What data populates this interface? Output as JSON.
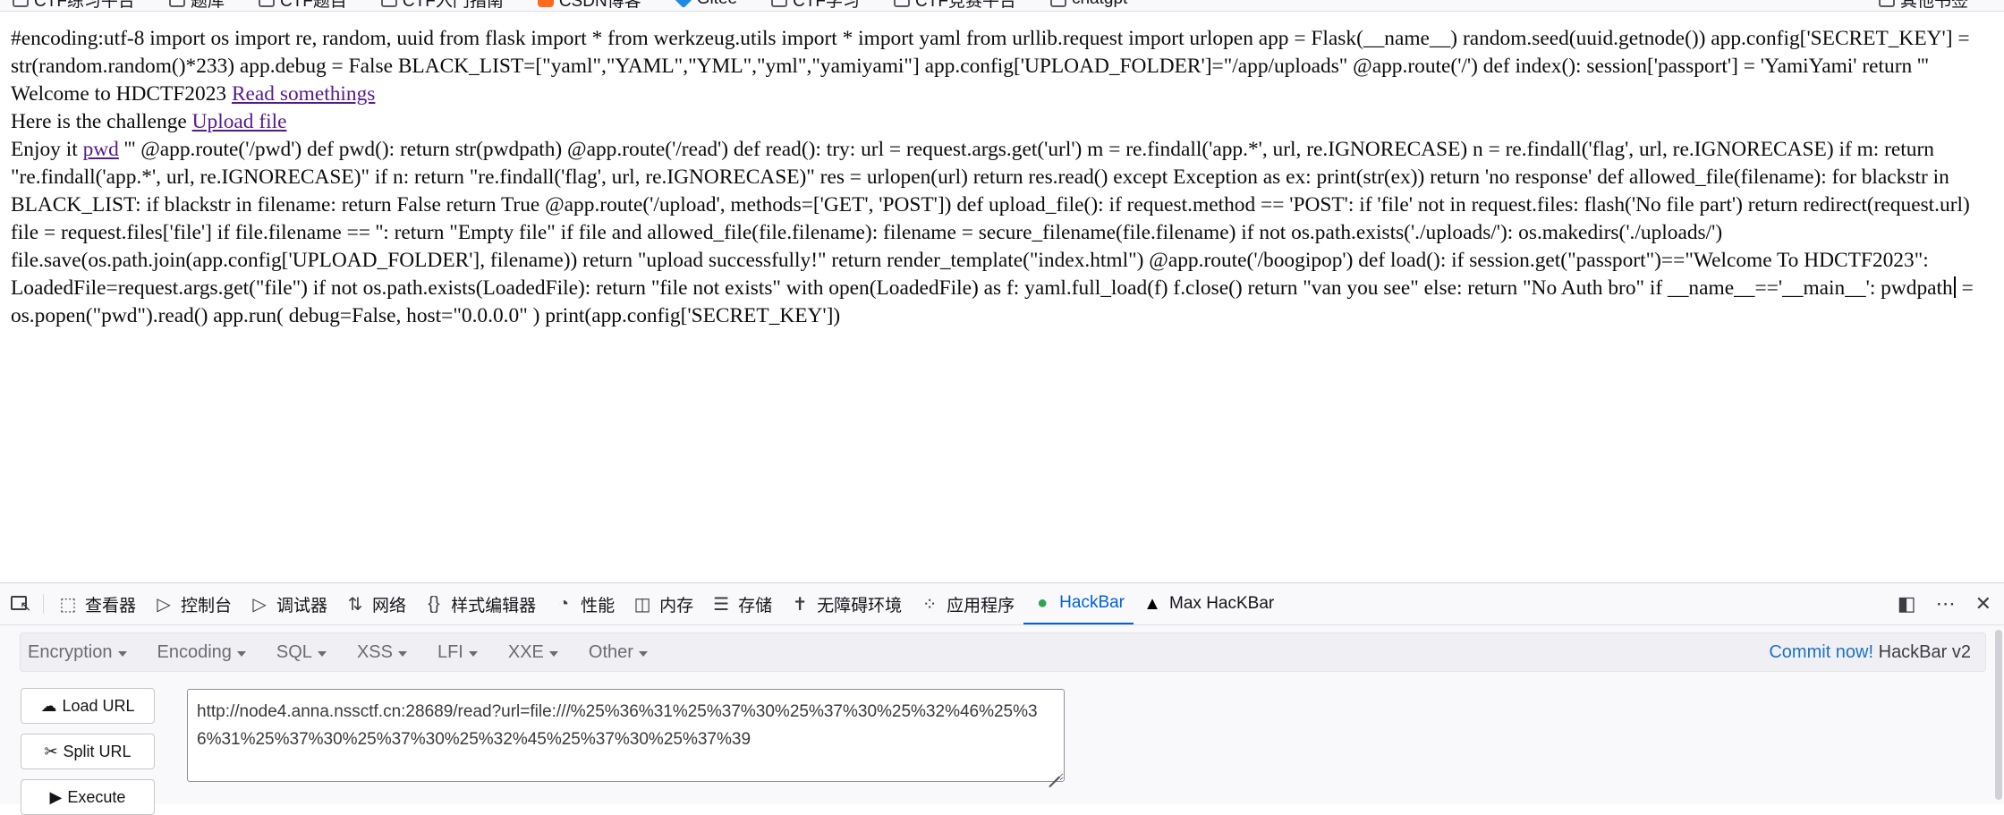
{
  "bookmarks": {
    "items": [
      "CTF练习平台",
      "题库",
      "CTF题目",
      "CTF入门指南",
      "CSDN博客",
      "Gitee",
      "CTF学习",
      "CTF竞赛平台",
      "chatgpt"
    ],
    "right_label": "其他书签"
  },
  "page": {
    "line1": "#encoding:utf-8 import os import re, random, uuid from flask import * from werkzeug.utils import * import yaml from urllib.request import urlopen app = Flask(__name__) random.seed(uuid.getnode()) app.config['SECRET_KEY'] = str(random.random()*233) app.debug = False BLACK_LIST=[\"yaml\",\"YAML\",\"YML\",\"yml\",\"yamiyami\"] app.config['UPLOAD_FOLDER']=\"/app/uploads\" @app.route('/') def index(): session['passport'] = 'YamiYami' return ''' Welcome to HDCTF2023 ",
    "link_read": "Read somethings",
    "challenge_prefix": "Here is the challenge ",
    "link_upload": "Upload file",
    "enjoy_prefix": "Enjoy it ",
    "link_pwd": "pwd",
    "code_rest_a": " ''' @app.route('/pwd') def pwd(): return str(pwdpath) @app.route('/read') def read(): try: url = request.args.get('url') m = re.findall('app.*', url, re.IGNORECASE) n = re.findall('flag', url, re.IGNORECASE) if m: return \"re.findall('app.*', url, re.IGNORECASE)\" if n: return \"re.findall('flag', url, re.IGNORECASE)\" res = urlopen(url) return res.read() except Exception as ex: print(str(ex)) return 'no response' def allowed_file(filename): for blackstr in BLACK_LIST: if blackstr in filename: return False return True @app.route('/upload', methods=['GET', 'POST']) def upload_file(): if request.method == 'POST': if 'file' not in request.files: flash('No file part') return redirect(request.url) file = request.files['file'] if file.filename == '': return \"Empty file\" if file and allowed_file(file.filename): filename = secure_filename(file.filename) if not os.path.exists('./uploads/'): os.makedirs('./uploads/') file.save(os.path.join(app.config['UPLOAD_FOLDER'], filename)) return \"upload successfully!\" return render_template(\"index.html\") @app.route('/boogipop') def load(): if session.get(\"passport\")==\"Welcome To HDCTF2023\": LoadedFile=request.args.get(\"file\") if not os.path.exists(LoadedFile): return \"file not exists\" with open(LoadedFile) as f: yaml.full_load(f) f.close() return \"van you see\" else: return \"No Auth bro\" if __name__=='__main__': pwdpath",
    "code_rest_b": " = os.popen(\"pwd\").read() app.run( debug=False, host=\"0.0.0.0\" ) print(app.config['SECRET_KEY'])"
  },
  "devtools": {
    "tabs": [
      {
        "label": "查看器",
        "icon": "inspector-icon"
      },
      {
        "label": "控制台",
        "icon": "console-icon"
      },
      {
        "label": "调试器",
        "icon": "debugger-icon"
      },
      {
        "label": "网络",
        "icon": "network-icon"
      },
      {
        "label": "样式编辑器",
        "icon": "style-editor-icon"
      },
      {
        "label": "性能",
        "icon": "performance-icon"
      },
      {
        "label": "内存",
        "icon": "memory-icon"
      },
      {
        "label": "存储",
        "icon": "storage-icon"
      },
      {
        "label": "无障碍环境",
        "icon": "accessibility-icon"
      },
      {
        "label": "应用程序",
        "icon": "application-icon"
      },
      {
        "label": "HackBar",
        "icon": "hackbar-icon"
      },
      {
        "label": "Max HacKBar",
        "icon": "max-hackbar-icon"
      }
    ],
    "active_tab": "HackBar",
    "accent_color": "#0060df"
  },
  "hackbar": {
    "menus": [
      "Encryption",
      "Encoding",
      "SQL",
      "XSS",
      "LFI",
      "XXE",
      "Other"
    ],
    "commit_link": "Commit now!",
    "version": " HackBar v2",
    "buttons": {
      "load": "Load URL",
      "split": "Split URL",
      "execute": "Execute"
    },
    "url_value": "http://node4.anna.nssctf.cn:28689/read?url=file:///%25%36%31%25%37%30%25%37%30%25%32%46%25%36%31%25%37%30%25%37%30%25%32%45%25%37%30%25%37%39"
  }
}
